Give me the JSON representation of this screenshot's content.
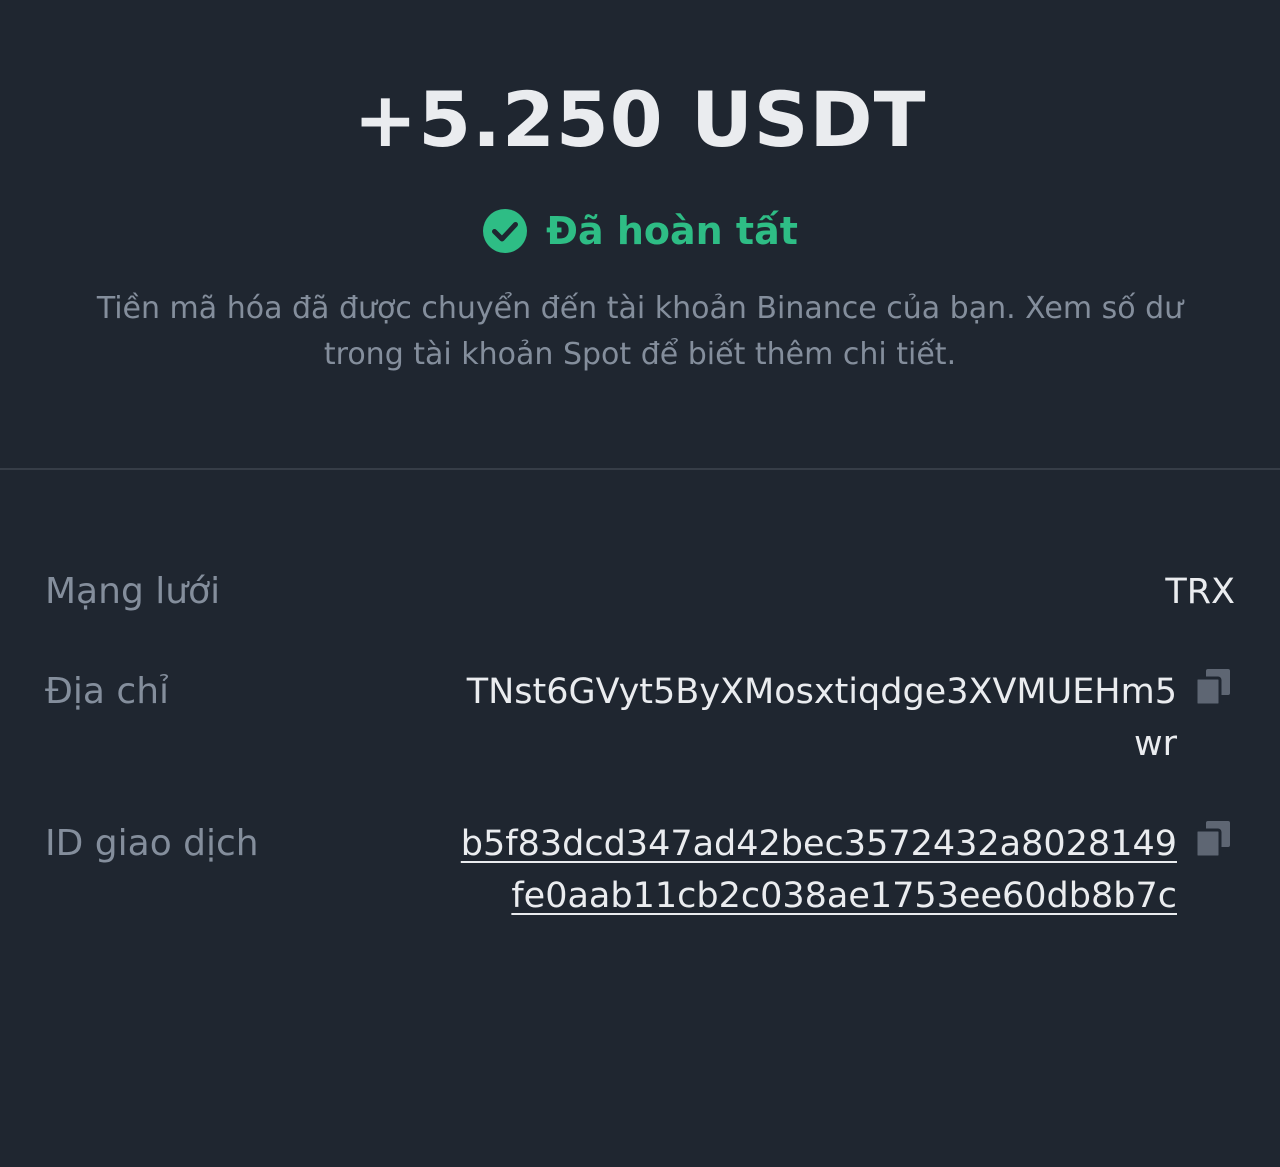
{
  "amount": "+5.250 USDT",
  "status": {
    "label": "Đã hoàn tất",
    "icon": "check-circle-icon",
    "color": "#2ebd85"
  },
  "description": "Tiền mã hóa đã được chuyển đến tài khoản Binance của bạn. Xem số dư trong tài khoản Spot để biết thêm chi tiết.",
  "details": {
    "network": {
      "label": "Mạng lưới",
      "value": "TRX"
    },
    "address": {
      "label": "Địa chỉ",
      "value": "TNst6GVyt5ByXMosxtiqdge3XVMUEHm5wr",
      "copy_icon": "copy-icon"
    },
    "txid": {
      "label": "ID giao dịch",
      "value": "b5f83dcd347ad42bec3572432a8028149fe0aab11cb2c038ae1753ee60db8b7c",
      "copy_icon": "copy-icon"
    }
  },
  "colors": {
    "background": "#1f2630",
    "text_primary": "#eaecef",
    "text_secondary": "#848e9c",
    "success": "#2ebd85",
    "divider": "#363d47"
  }
}
